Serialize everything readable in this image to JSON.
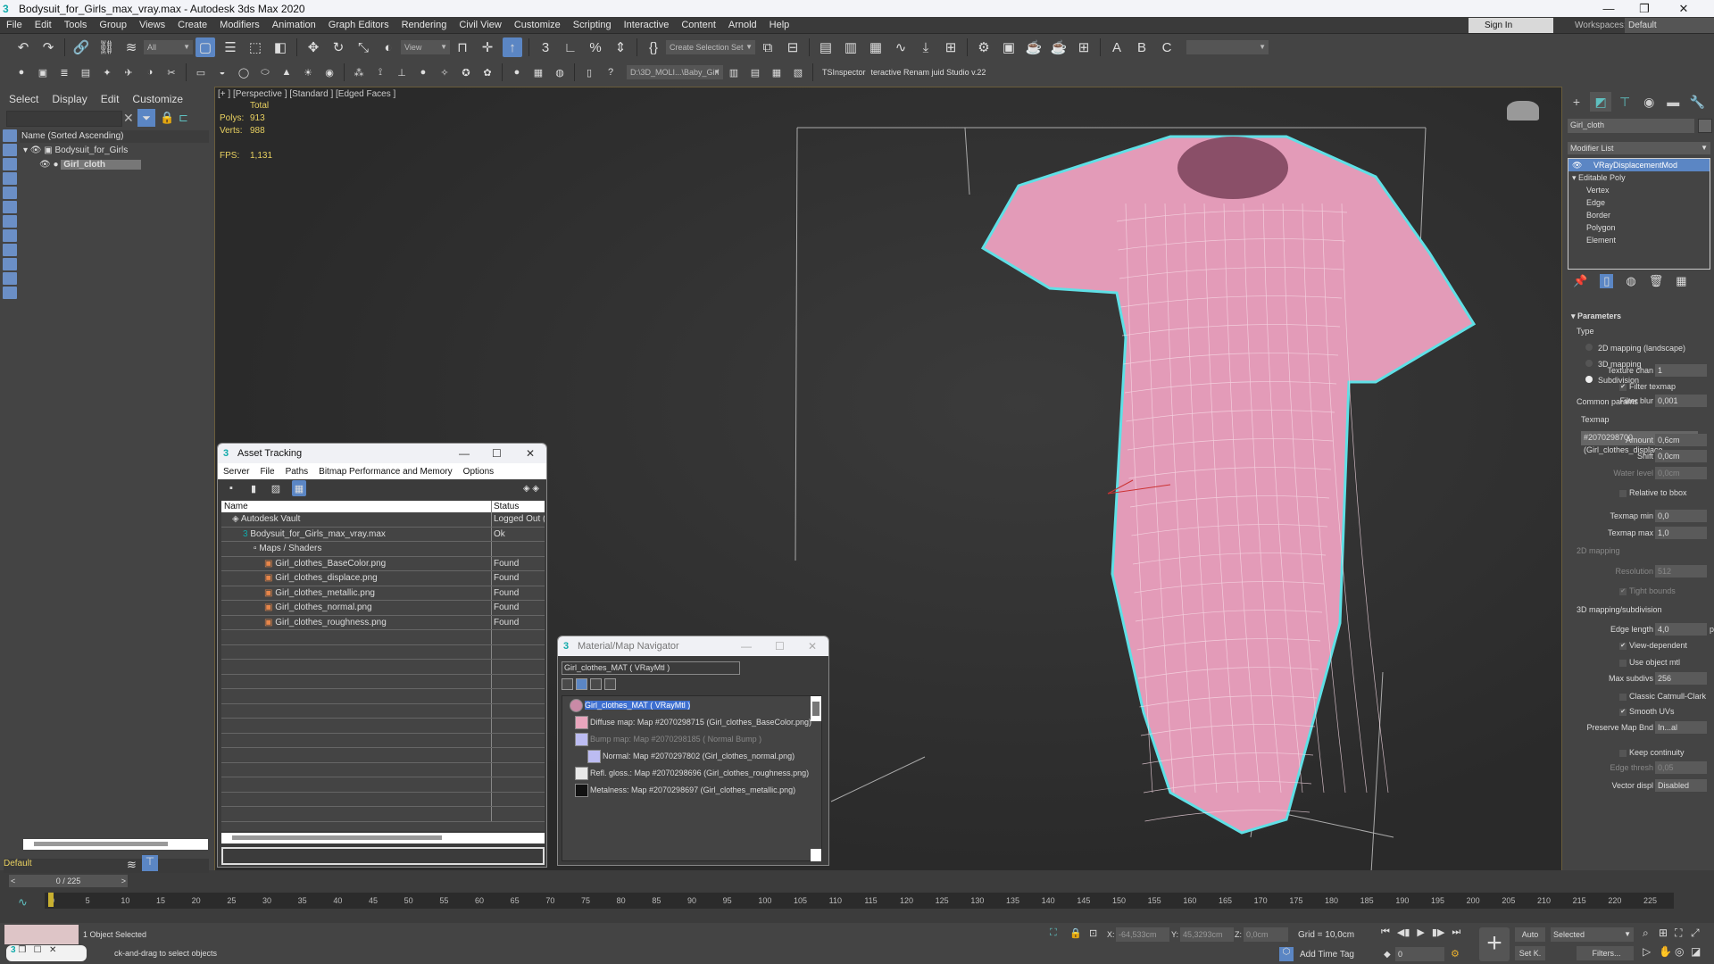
{
  "window": {
    "title": "Bodysuit_for_Girls_max_vray.max - Autodesk 3ds Max 2020",
    "controls": [
      "minimize",
      "restore",
      "close"
    ]
  },
  "menubar": {
    "items": [
      "File",
      "Edit",
      "Tools",
      "Group",
      "Views",
      "Create",
      "Modifiers",
      "Animation",
      "Graph Editors",
      "Rendering",
      "Civil View",
      "Customize",
      "Scripting",
      "Interactive",
      "Content",
      "Arnold",
      "Help"
    ],
    "sign_in": "Sign In",
    "workspaces_label": "Workspaces:",
    "workspace_value": "Default"
  },
  "toolbar": {
    "selection_filter": "All",
    "ref_coord": "View",
    "named_selection": "Create Selection Set",
    "path_dropdown": "D:\\3D_MOLI...\\Baby_Girl",
    "ts_inspector": "TSInspector",
    "rename_tool": "teractive Renam juid Studio v.22"
  },
  "scene_explorer": {
    "tabs": [
      "Select",
      "Display",
      "Edit",
      "Customize"
    ],
    "column_header": "Name (Sorted Ascending)",
    "rows": [
      {
        "name": "Bodysuit_for_Girls"
      },
      {
        "name": "Girl_cloth",
        "selected": true
      }
    ],
    "layer": "Default",
    "time_slider": "0 / 225"
  },
  "viewport": {
    "label": "[+ ] [Perspective ]  [Standard ]  [Edged Faces ]",
    "stats": {
      "header": "Total",
      "polys_label": "Polys:",
      "polys": "913",
      "verts_label": "Verts:",
      "verts": "988",
      "fps_label": "FPS:",
      "fps": "1,131"
    },
    "object_color": "#e39bb8",
    "selection_outline": "#5fe0e6"
  },
  "asset_tracking": {
    "title": "Asset Tracking",
    "menu": [
      "Server",
      "File",
      "Paths",
      "Bitmap Performance and Memory",
      "Options"
    ],
    "columns": [
      "Name",
      "Status"
    ],
    "rows": [
      {
        "name": "Autodesk Vault",
        "status": "Logged Out (",
        "indent": 1,
        "icon": "vault-icon"
      },
      {
        "name": "Bodysuit_for_Girls_max_vray.max",
        "status": "Ok",
        "indent": 2,
        "icon": "max-file-icon"
      },
      {
        "name": "Maps / Shaders",
        "status": "",
        "indent": 3,
        "icon": "maps-icon"
      },
      {
        "name": "Girl_clothes_BaseColor.png",
        "status": "Found",
        "indent": 4,
        "icon": "png-icon"
      },
      {
        "name": "Girl_clothes_displace.png",
        "status": "Found",
        "indent": 4,
        "icon": "png-icon"
      },
      {
        "name": "Girl_clothes_metallic.png",
        "status": "Found",
        "indent": 4,
        "icon": "png-icon"
      },
      {
        "name": "Girl_clothes_normal.png",
        "status": "Found",
        "indent": 4,
        "icon": "png-icon"
      },
      {
        "name": "Girl_clothes_roughness.png",
        "status": "Found",
        "indent": 4,
        "icon": "png-icon"
      }
    ]
  },
  "material_navigator": {
    "title": "Material/Map Navigator",
    "field": "Girl_clothes_MAT  ( VRayMtl )",
    "tree": [
      {
        "label": "Girl_clothes_MAT  ( VRayMtl )",
        "selected": true,
        "swatch": "#c98aa6"
      },
      {
        "label": "Diffuse map: Map #2070298715 (Girl_clothes_BaseColor.png)",
        "swatch": "#e9a6bd"
      },
      {
        "label": "Bump map: Map #2070298185  ( Normal Bump )",
        "dim": true,
        "swatch": "#bcbcf2"
      },
      {
        "label": "Normal: Map #2070297802 (Girl_clothes_normal.png)",
        "swatch": "#bcbcf2"
      },
      {
        "label": "Refl. gloss.: Map #2070298696 (Girl_clothes_roughness.png)",
        "swatch": "#e8e8e8"
      },
      {
        "label": "Metalness: Map #2070298697 (Girl_clothes_metallic.png)",
        "swatch": "#111111"
      }
    ]
  },
  "command_panel": {
    "object_name": "Girl_cloth",
    "modifier_list": "Modifier List",
    "stack": [
      {
        "label": "VRayDisplacementMod",
        "selected": true
      },
      {
        "label": "Editable Poly"
      },
      {
        "label": "Vertex"
      },
      {
        "label": "Edge"
      },
      {
        "label": "Border"
      },
      {
        "label": "Polygon"
      },
      {
        "label": "Element"
      }
    ],
    "rollout_title": "Parameters",
    "type_group": "Type",
    "type_options": [
      {
        "label": "2D mapping (landscape)",
        "checked": false
      },
      {
        "label": "3D mapping",
        "checked": false
      },
      {
        "label": "Subdivision",
        "checked": true
      }
    ],
    "common_params": "Common params",
    "texmap_label": "Texmap",
    "texmap_value": "#2070298700 (Girl_clothes_displace.",
    "texture_chan_label": "Texture chan",
    "texture_chan": "1",
    "filter_texmap": "Filter texmap",
    "filter_blur_label": "Filter blur",
    "filter_blur": "0,001",
    "amount_label": "Amount",
    "amount": "0,6cm",
    "shift_label": "Shift",
    "shift": "0,0cm",
    "water_level_label": "Water level",
    "water_level": "0,0cm",
    "relative_bbox": "Relative to bbox",
    "texmap_min_label": "Texmap min",
    "texmap_min": "0,0",
    "texmap_max_label": "Texmap max",
    "texmap_max": "1,0",
    "mapping2d_group": "2D mapping",
    "resolution_label": "Resolution",
    "resolution": "512",
    "tight_bounds": "Tight bounds",
    "mapping3d_group": "3D mapping/subdivision",
    "edge_length_label": "Edge length",
    "edge_length": "4,0",
    "edge_length_unit": "pixels",
    "view_dependent": "View-dependent",
    "use_object_mtl": "Use object mtl",
    "max_subdivs_label": "Max subdivs",
    "max_subdivs": "256",
    "classic_catmull": "Classic Catmull-Clark",
    "smooth_uvs": "Smooth UVs",
    "preserve_map_label": "Preserve Map Bnd",
    "preserve_map": "In...al",
    "keep_continuity": "Keep continuity",
    "edge_thresh_label": "Edge thresh",
    "edge_thresh": "0,05",
    "vector_displ_label": "Vector displ",
    "vector_displ": "Disabled"
  },
  "timeline": {
    "start": 0,
    "end": 225,
    "current": 0,
    "ticks": [
      "0",
      "5",
      "10",
      "15",
      "20",
      "25",
      "30",
      "35",
      "40",
      "45",
      "50",
      "55",
      "60",
      "65",
      "70",
      "75",
      "80",
      "85",
      "90",
      "95",
      "100",
      "105",
      "110",
      "115",
      "120",
      "125",
      "130",
      "135",
      "140",
      "145",
      "150",
      "155",
      "160",
      "165",
      "170",
      "175",
      "180",
      "185",
      "190",
      "195",
      "200",
      "205",
      "210",
      "215",
      "220",
      "225"
    ]
  },
  "status": {
    "selected": "1 Object Selected",
    "prompt": "ck-and-drag to select objects",
    "x_label": "X:",
    "x": "-64,533cm",
    "y_label": "Y:",
    "y": "45,3293cm",
    "z_label": "Z:",
    "z": "0,0cm",
    "grid": "Grid = 10,0cm",
    "add_time_tag": "Add Time Tag",
    "frame": "0",
    "auto": "Auto",
    "set_key": "Set K.",
    "key_filter": "Selected",
    "filters": "Filters..."
  }
}
